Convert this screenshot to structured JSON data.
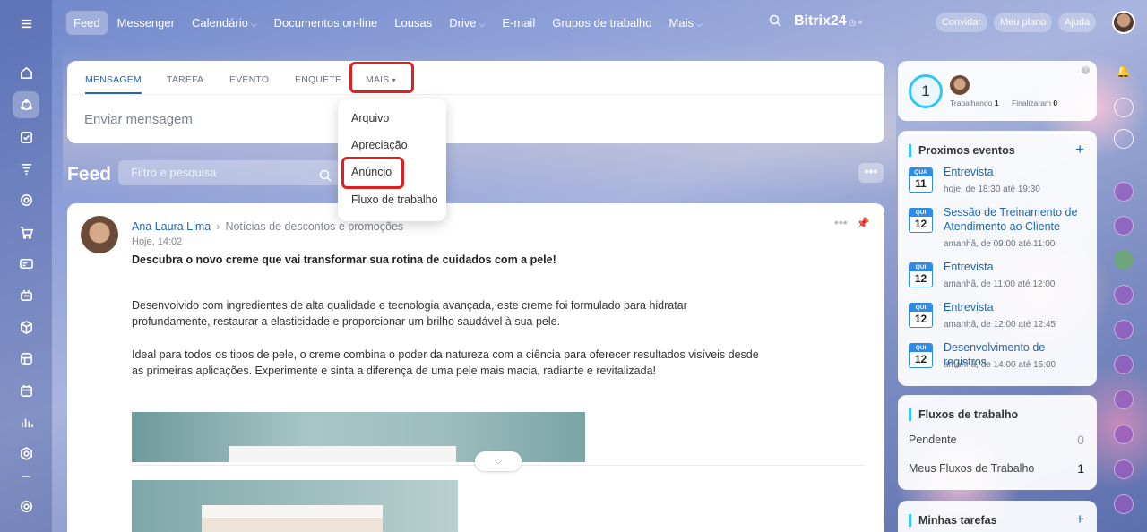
{
  "topnav": {
    "items": [
      {
        "label": "Feed",
        "caret": false
      },
      {
        "label": "Messenger",
        "caret": false
      },
      {
        "label": "Calendário",
        "caret": true
      },
      {
        "label": "Documentos on-line",
        "caret": false
      },
      {
        "label": "Lousas",
        "caret": false
      },
      {
        "label": "Drive",
        "caret": true
      },
      {
        "label": "E-mail",
        "caret": false
      },
      {
        "label": "Grupos de trabalho",
        "caret": false
      },
      {
        "label": "Mais",
        "caret": true
      }
    ],
    "caret_glyph": "⌵",
    "brand": "Bitrix",
    "brand_num": "24",
    "invite": "Convidar",
    "plan": "Meu plano",
    "help": "Ajuda"
  },
  "left_rail": {
    "icons": [
      "home-icon",
      "feed-icon",
      "tasks-icon",
      "filter-icon",
      "crm-icon",
      "store-icon",
      "contacts-icon",
      "robot-icon",
      "box-icon",
      "sites-icon",
      "calendar-grid-icon",
      "analytics-icon",
      "hex-icon",
      "settings-icon"
    ]
  },
  "composer": {
    "tabs": {
      "mensagem": "MENSAGEM",
      "tarefa": "TAREFA",
      "evento": "EVENTO",
      "enquete": "ENQUETE",
      "mais": "MAIS"
    },
    "mais_caret": "▾",
    "placeholder": "Enviar mensagem"
  },
  "dropdown": {
    "items": [
      "Arquivo",
      "Apreciação",
      "Anúncio",
      "Fluxo de trabalho"
    ]
  },
  "feed": {
    "title": "Feed",
    "filter_placeholder": "Filtro e pesquisa",
    "more": "•••"
  },
  "post": {
    "author": "Ana Laura Lima",
    "separator": "›",
    "destination": "Notícias de descontos e promoções",
    "time": "Hoje, 14:02",
    "title": "Descubra o novo creme que vai transformar sua rotina de cuidados com a pele!",
    "para1": "Desenvolvido com ingredientes de alta qualidade e tecnologia avançada, este creme foi formulado para hidratar profundamente, restaurar a elasticidade e proporcionar um brilho saudável à sua pele.",
    "para2": "Ideal para todos os tipos de pele, o creme combina o poder da natureza com a ciência para oferecer resultados visíveis desde as primeiras aplicações. Experimente e sinta a diferença de uma pele mais macia, radiante e revitalizada!",
    "actions": "•••",
    "expand": "⌵"
  },
  "worktime": {
    "count": "1",
    "working_label": "Trabalhando",
    "working_value": "1",
    "finished_label": "Finalizaram",
    "finished_value": "0",
    "help": "?"
  },
  "events": {
    "title": "Proximos eventos",
    "plus": "+",
    "items": [
      {
        "dow": "QUA",
        "day": "11",
        "title": "Entrevista",
        "time": "hoje, de 18:30 até 19:30"
      },
      {
        "dow": "QUI",
        "day": "12",
        "title": "Sessão de Treinamento de Atendimento ao Cliente",
        "time": "amanhã, de 09:00 até 11:00"
      },
      {
        "dow": "QUI",
        "day": "12",
        "title": "Entrevista",
        "time": "amanhã, de 11:00 até 12:00"
      },
      {
        "dow": "QUI",
        "day": "12",
        "title": "Entrevista",
        "time": "amanhã, de 12:00 até 12:45"
      },
      {
        "dow": "QUI",
        "day": "12",
        "title": "Desenvolvimento de registros",
        "time": "amanhã, de 14:00 até 15:00"
      }
    ]
  },
  "workflows": {
    "title": "Fluxos de trabalho",
    "pending_label": "Pendente",
    "pending_value": "0",
    "mine_label": "Meus Fluxos de Trabalho",
    "mine_value": "1"
  },
  "tasks": {
    "title": "Minhas tarefas",
    "plus": "+"
  },
  "colors": {
    "accent": "#2067b0",
    "highlight_box": "#e02020",
    "calendar": "#2f8be3",
    "worktime_ring": "#2fc6f6"
  }
}
